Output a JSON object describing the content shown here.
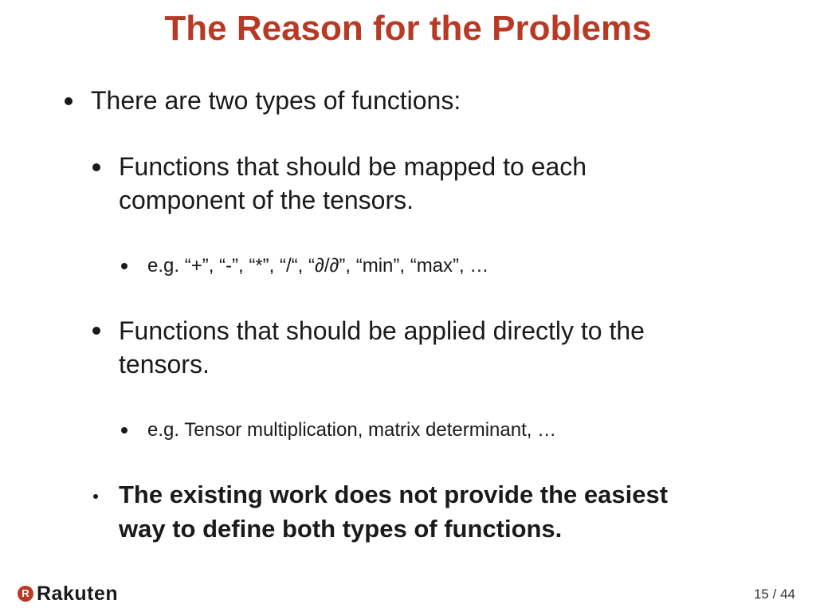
{
  "slide": {
    "title": "The Reason for the Problems",
    "bullets": {
      "intro": "There are two types of functions:",
      "mapped_line1": "Functions that should be mapped to each",
      "mapped_line2": "component of the tensors.",
      "mapped_example": "e.g. “+”, “-”, “*”, “/“, “∂/∂”, “min”, “max”, …",
      "applied_line1": "Functions that should be applied directly to the",
      "applied_line2": "tensors.",
      "applied_example": "e.g. Tensor multiplication, matrix determinant, …",
      "conclusion_line1": "The existing work does not provide the easiest",
      "conclusion_line2": "way to define both types of functions."
    }
  },
  "footer": {
    "logo_text": "Rakuten",
    "logo_mark": "R",
    "page_current": "15",
    "page_total": "44",
    "page_separator": "/"
  },
  "colors": {
    "title": "#b83a24",
    "text": "#1a1a1a",
    "brand": "#b83a24"
  }
}
